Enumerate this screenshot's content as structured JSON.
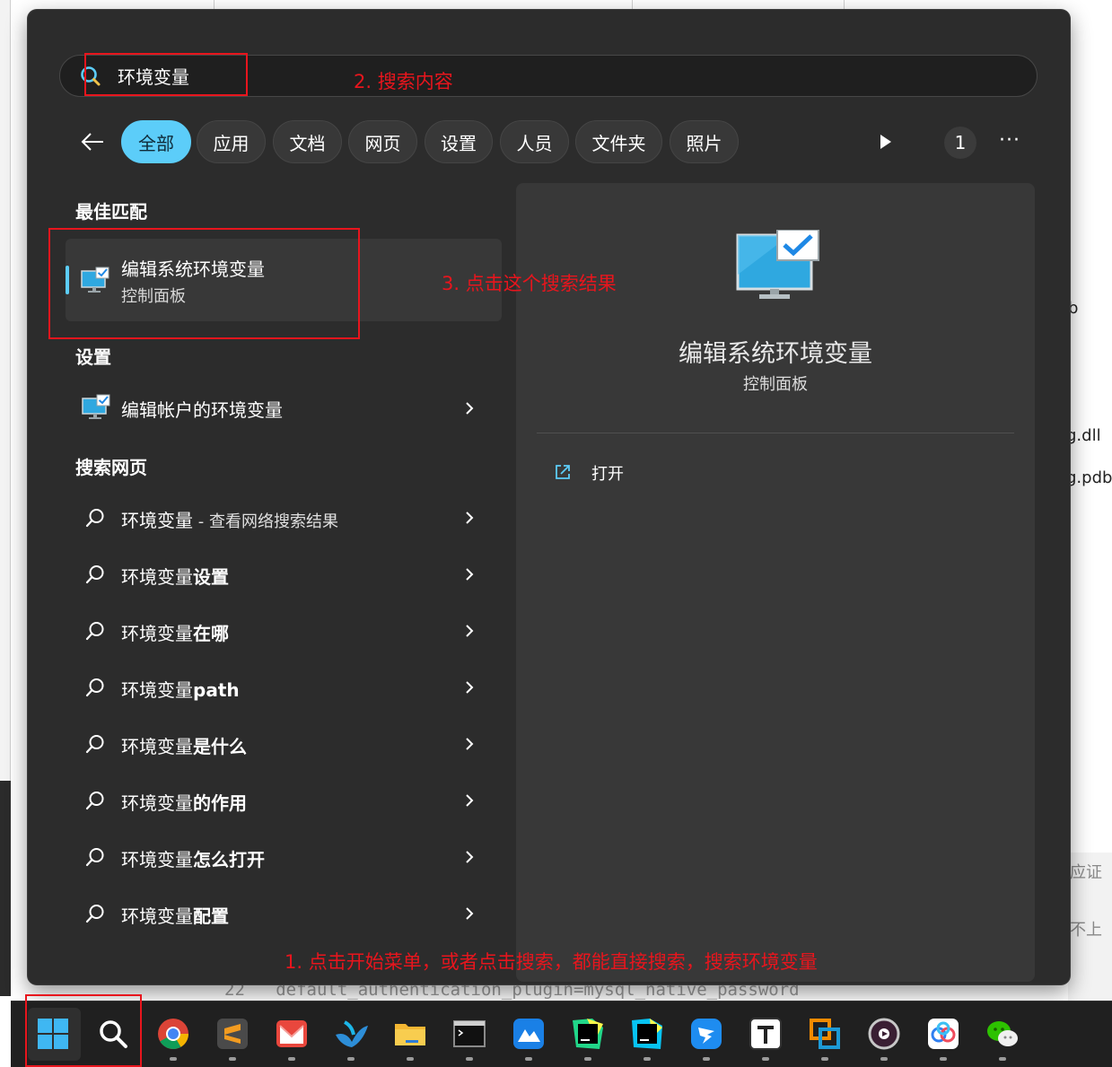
{
  "background": {
    "fragments": [
      "b",
      "g.dll",
      "g.pdb",
      "应证",
      "不上"
    ],
    "code_line_number": "22",
    "code_line_text": "default_authentication_plugin=mysql_native_password"
  },
  "search": {
    "query": "环境变量",
    "icon": "search-icon"
  },
  "filters": {
    "back_icon": "back-arrow-icon",
    "tabs": [
      {
        "label": "全部",
        "active": true
      },
      {
        "label": "应用",
        "active": false
      },
      {
        "label": "文档",
        "active": false
      },
      {
        "label": "网页",
        "active": false
      },
      {
        "label": "设置",
        "active": false
      },
      {
        "label": "人员",
        "active": false
      },
      {
        "label": "文件夹",
        "active": false
      },
      {
        "label": "照片",
        "active": false
      }
    ],
    "play_icon": "play-icon",
    "count": "1",
    "more_icon": "more-icon"
  },
  "best_match": {
    "heading": "最佳匹配",
    "title": "编辑系统环境变量",
    "subtitle": "控制面板",
    "icon": "control-panel-monitor-icon"
  },
  "settings_section": {
    "heading": "设置",
    "items": [
      {
        "label": "编辑帐户的环境变量",
        "icon": "control-panel-monitor-icon"
      }
    ]
  },
  "web_section": {
    "heading": "搜索网页",
    "items": [
      {
        "prefix": "环境变量",
        "suffix": " - 查看网络搜索结果",
        "suffix_bold": false
      },
      {
        "prefix": "环境变量",
        "suffix": "设置",
        "suffix_bold": true
      },
      {
        "prefix": "环境变量",
        "suffix": "在哪",
        "suffix_bold": true
      },
      {
        "prefix": "环境变量",
        "suffix": "path",
        "suffix_bold": true
      },
      {
        "prefix": "环境变量",
        "suffix": "是什么",
        "suffix_bold": true
      },
      {
        "prefix": "环境变量",
        "suffix": "的作用",
        "suffix_bold": true
      },
      {
        "prefix": "环境变量",
        "suffix": "怎么打开",
        "suffix_bold": true
      },
      {
        "prefix": "环境变量",
        "suffix": "配置",
        "suffix_bold": true
      }
    ]
  },
  "preview": {
    "title": "编辑系统环境变量",
    "subtitle": "控制面板",
    "actions": [
      {
        "label": "打开",
        "icon": "open-external-icon"
      }
    ]
  },
  "annotations": {
    "step1": "1. 点击开始菜单，或者点击搜索，都能直接搜索，搜索环境变量",
    "step2": "2. 搜索内容",
    "step3": "3. 点击这个搜索结果",
    "color": "#e8151d"
  },
  "taskbar": {
    "items": [
      {
        "name": "start",
        "icon": "windows-start-icon",
        "running": false
      },
      {
        "name": "search",
        "icon": "search-icon",
        "running": false
      },
      {
        "name": "chrome",
        "icon": "chrome-icon",
        "running": true
      },
      {
        "name": "sublime",
        "icon": "sublime-text-icon",
        "running": true
      },
      {
        "name": "mail",
        "icon": "mail-app-icon",
        "running": true
      },
      {
        "name": "feishu",
        "icon": "bird-app-icon",
        "running": true
      },
      {
        "name": "explorer",
        "icon": "folder-icon",
        "running": true
      },
      {
        "name": "terminal",
        "icon": "terminal-icon",
        "running": true
      },
      {
        "name": "meeting",
        "icon": "mountain-app-icon",
        "running": true
      },
      {
        "name": "pycharm",
        "icon": "pycharm-icon",
        "running": true
      },
      {
        "name": "webstorm",
        "icon": "webstorm-icon",
        "running": true
      },
      {
        "name": "dingtalk",
        "icon": "dingtalk-icon",
        "running": true
      },
      {
        "name": "typora",
        "icon": "typora-icon",
        "running": true
      },
      {
        "name": "vmware",
        "icon": "vmware-icon",
        "running": true
      },
      {
        "name": "player",
        "icon": "media-player-icon",
        "running": true
      },
      {
        "name": "baidu-netdisk",
        "icon": "cloud-disk-icon",
        "running": true
      },
      {
        "name": "wechat",
        "icon": "wechat-icon",
        "running": true
      }
    ]
  },
  "colors": {
    "accent": "#5ccdf9",
    "panel": "#2c2c2c",
    "card": "#383838",
    "taskbar": "#202020"
  }
}
